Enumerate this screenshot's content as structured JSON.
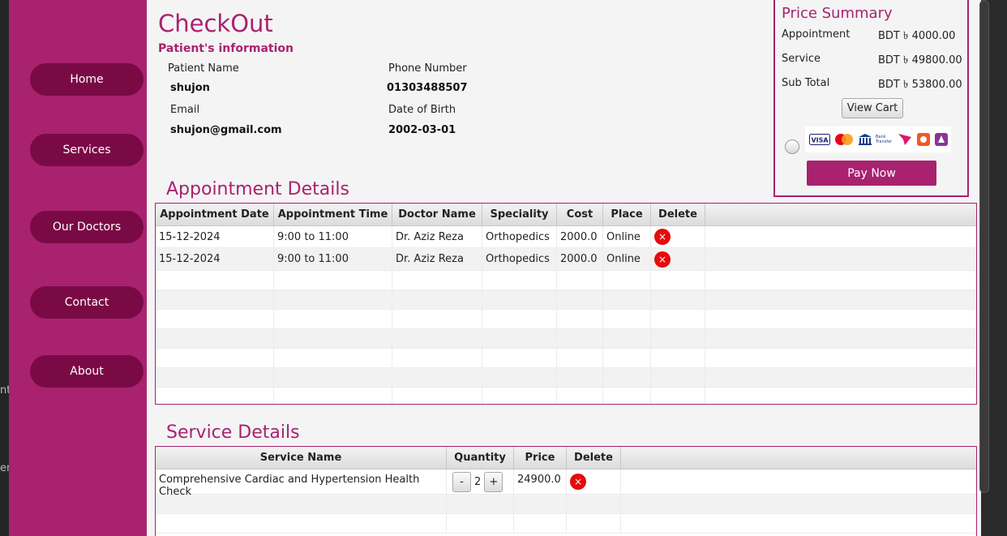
{
  "background_clip": [
    "nt",
    "en"
  ],
  "nav": [
    "Home",
    "Services",
    "Our Doctors",
    "Contact",
    "About"
  ],
  "page": {
    "title": "CheckOut",
    "subtitle": "Patient's information"
  },
  "patient": {
    "name_label": "Patient Name",
    "name": "shujon",
    "phone_label": "Phone Number",
    "phone": "01303488507",
    "email_label": "Email",
    "email": "shujon@gmail.com",
    "dob_label": "Date of Birth",
    "dob": "2002-03-01"
  },
  "summary": {
    "title": "Price Summary",
    "appointment_label": "Appointment",
    "appointment_value": "BDT ৳ 4000.00",
    "service_label": "Service",
    "service_value": "BDT ৳ 49800.00",
    "subtotal_label": "Sub Total",
    "subtotal_value": "BDT ৳ 53800.00",
    "view_cart": "View Cart",
    "pay_now": "Pay Now",
    "payment_methods": [
      "visa-logo",
      "mastercard-logo",
      "bank-transfer-logo",
      "bkash-logo",
      "nagad-logo",
      "rocket-logo"
    ],
    "bank_transfer_text": "Bank Transfer"
  },
  "appointments": {
    "title": "Appointment Details",
    "columns": [
      "Appointment Date",
      "Appointment Time",
      "Doctor Name",
      "Speciality",
      "Cost",
      "Place",
      "Delete"
    ],
    "rows": [
      [
        "15-12-2024",
        "9:00 to 11:00",
        "Dr. Aziz Reza",
        "Orthopedics",
        "2000.0",
        "Online"
      ],
      [
        "15-12-2024",
        "9:00 to 11:00",
        "Dr. Aziz Reza",
        "Orthopedics",
        "2000.0",
        "Online"
      ]
    ],
    "delete_glyph": "×"
  },
  "services": {
    "title": "Service Details",
    "columns": [
      "Service Name",
      "Quantity",
      "Price",
      "Delete"
    ],
    "rows": [
      {
        "name": "Comprehensive Cardiac and Hypertension Health Check",
        "minus": "-",
        "qty": "2",
        "plus": "+",
        "price": "24900.0"
      }
    ]
  },
  "colors": {
    "brand": "#a8226f",
    "nav_button": "#7a0a46",
    "delete": "#e60b0b"
  }
}
